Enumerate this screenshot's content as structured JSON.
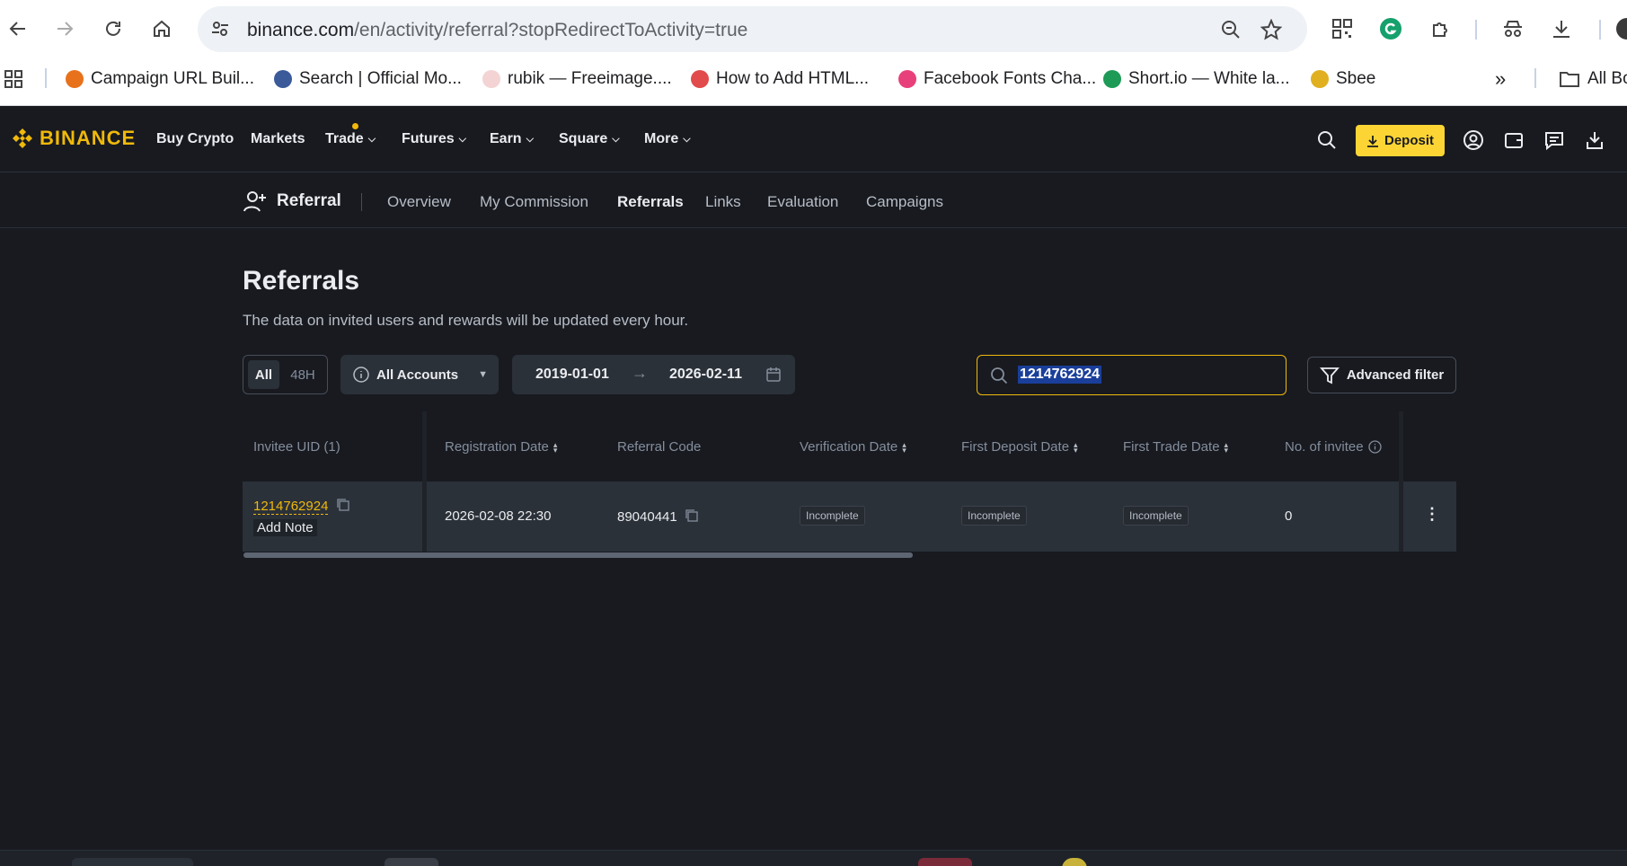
{
  "browser": {
    "url_host": "binance.com",
    "url_path": "/en/activity/referral?stopRedirectToActivity=true",
    "bookmarks": [
      {
        "label": "Campaign URL Buil...",
        "color": "#e8711c"
      },
      {
        "label": "Search | Official Mo...",
        "color": "#3b5a9a"
      },
      {
        "label": "rubik — Freeimage....",
        "color": "#d9534f"
      },
      {
        "label": "How to Add HTML...",
        "color": "#e14b4b"
      },
      {
        "label": "Facebook Fonts Cha...",
        "color": "#e8407a"
      },
      {
        "label": "Short.io — White la...",
        "color": "#1d9a56"
      },
      {
        "label": "Sbee",
        "color": "#e0b020"
      }
    ],
    "all_bookmarks": "All Bo"
  },
  "header": {
    "logo_text": "BINANCE",
    "nav": [
      "Buy Crypto",
      "Markets",
      "Trade",
      "Futures",
      "Earn",
      "Square",
      "More"
    ],
    "deposit_label": "Deposit"
  },
  "subnav": {
    "title": "Referral",
    "tabs": [
      "Overview",
      "My Commission",
      "Referrals",
      "Links",
      "Evaluation",
      "Campaigns"
    ],
    "active": "Referrals"
  },
  "page": {
    "title": "Referrals",
    "description": "The data on invited users and rewards will be updated every hour."
  },
  "filters": {
    "range_all": "All",
    "range_48h": "48H",
    "accounts": "All Accounts",
    "date_from": "2019-01-01",
    "date_to": "2026-02-11",
    "search_value": "1214762924",
    "advanced_filter": "Advanced filter"
  },
  "table": {
    "headers": [
      "Invitee UID (1)",
      "Registration Date",
      "Referral Code",
      "Verification Date",
      "First Deposit Date",
      "First Trade Date",
      "No. of invitee"
    ],
    "rows": [
      {
        "uid": "1214762924",
        "note": "Add Note",
        "registration_date": "2026-02-08 22:30",
        "referral_code": "89040441",
        "verification": "Incomplete",
        "first_deposit": "Incomplete",
        "first_trade": "Incomplete",
        "invitees": "0"
      }
    ]
  },
  "colors": {
    "accent": "#f0b90b",
    "background": "#181a20",
    "panel": "#2b3139"
  }
}
